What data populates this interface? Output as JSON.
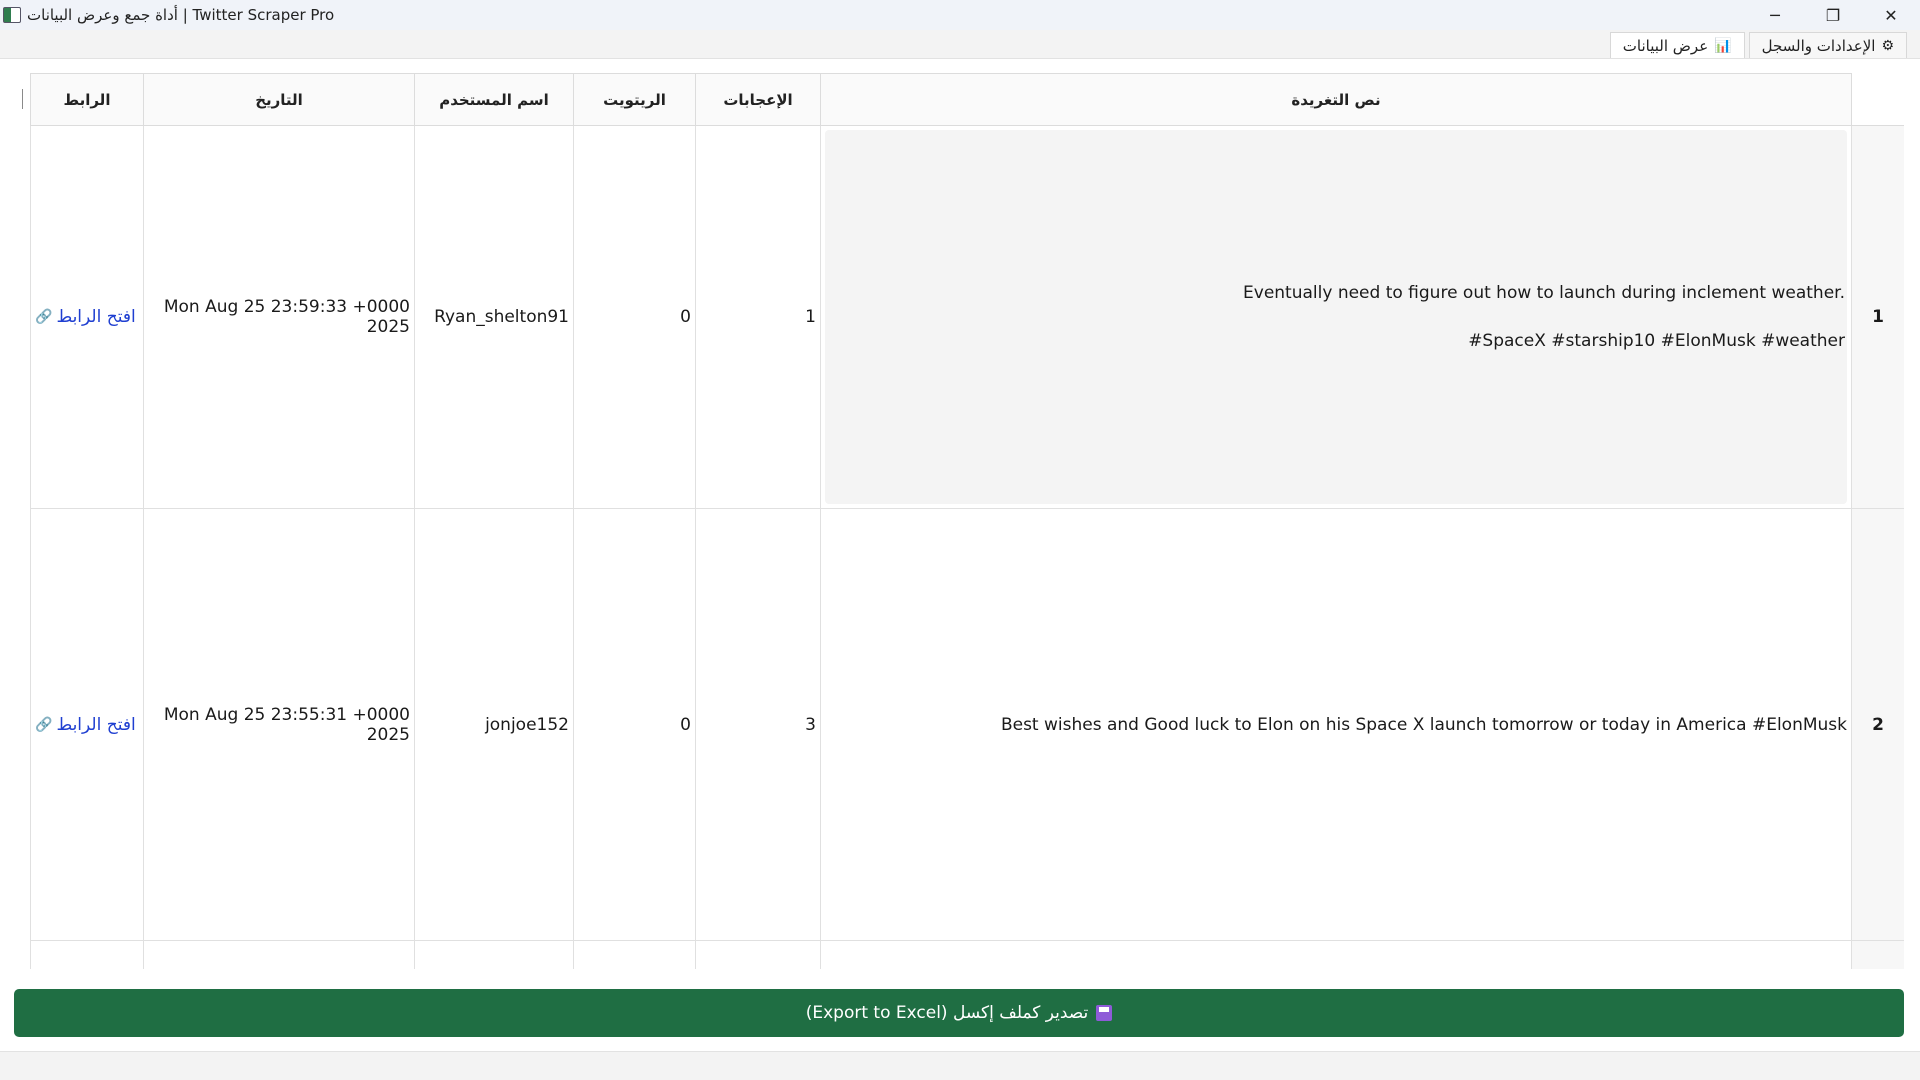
{
  "window": {
    "title": "أداة جمع وعرض البيانات | Twitter Scraper Pro",
    "controls": {
      "minimize": "─",
      "maximize": "❐",
      "close": "✕"
    }
  },
  "tabs": [
    {
      "label": "الإعدادات والسجل",
      "icon": "⚙",
      "icon_name": "gear-icon"
    },
    {
      "label": "عرض البيانات",
      "icon": "📊",
      "icon_name": "bar-chart-icon",
      "active": true
    }
  ],
  "table": {
    "headers": {
      "tweet": "نص التغريدة",
      "likes": "الإعجابات",
      "retweets": "الريتويت",
      "username": "اسم المستخدم",
      "date": "التاريخ",
      "link": "الرابط"
    },
    "rows": [
      {
        "index": "1",
        "tweet_line1": "Eventually need to figure out how to launch during inclement weather.",
        "tweet_line2": "#SpaceX #starship10 #ElonMusk #weather",
        "likes": "1",
        "retweets": "0",
        "username": "Ryan_shelton91",
        "date": "Mon Aug 25 23:59:33 +0000 2025",
        "link_label": "افتح الرابط",
        "link_icon": "🔗"
      },
      {
        "index": "2",
        "tweet": "Best wishes and Good luck to Elon on his Space X launch tomorrow or today in America #ElonMusk",
        "likes": "3",
        "retweets": "0",
        "username": "jonjoe152",
        "date": "Mon Aug 25 23:55:31 +0000 2025",
        "link_label": "افتح الرابط",
        "link_icon": "🔗"
      }
    ]
  },
  "export_button": {
    "label": "تصدير كملف إكسل (Export to Excel)",
    "icon_name": "floppy-disk-icon"
  },
  "colors": {
    "export_bg": "#1f6e43",
    "link": "#1f3fd1",
    "titlebar_bg": "#f0f3f9"
  }
}
